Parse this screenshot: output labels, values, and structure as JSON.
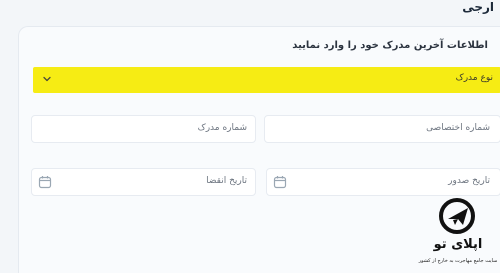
{
  "header": {
    "tab_fragment": "ارجی"
  },
  "form": {
    "title": "اطلاعات آخرین مدرک خود را وارد نمایید",
    "document_type": {
      "label": "نوع مدرک",
      "highlight_color": "#f6ec14"
    },
    "document_number": {
      "placeholder": "شماره مدرک"
    },
    "personal_number": {
      "placeholder": "شماره اختصاصی"
    },
    "expiry_date": {
      "placeholder": "تاریخ انقضا"
    },
    "issue_date": {
      "placeholder": "تاریخ صدور"
    }
  },
  "watermark": {
    "brand": "اپلای تو",
    "tagline": "سایت جامع مهاجرت به خارج از کشور"
  },
  "icons": {
    "select": "chevron-down-icon",
    "date": "calendar-icon",
    "logo": "globe-plane-logo"
  }
}
